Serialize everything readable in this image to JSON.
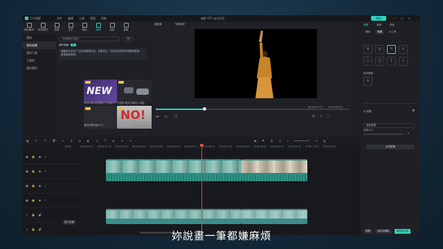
{
  "titlebar": {
    "app_name": "万兴喵影",
    "menu": [
      "文件",
      "编辑",
      "工具",
      "视图",
      "帮助"
    ],
    "document": "喵影-074 自动打码",
    "export_label": "导出"
  },
  "toolbar": {
    "tools": [
      {
        "label": "我的素材",
        "icon": "folder-icon"
      },
      {
        "label": "库存素材",
        "icon": "stock-icon"
      },
      {
        "label": "音频",
        "icon": "music-icon"
      },
      {
        "label": "文字",
        "icon": "text-icon"
      },
      {
        "label": "特效",
        "icon": "effects-icon"
      },
      {
        "label": "转场",
        "icon": "transition-icon"
      },
      {
        "label": "贴纸",
        "icon": "sticker-icon"
      },
      {
        "label": "模板",
        "icon": "template-icon"
      }
    ],
    "active_index": 5
  },
  "sidebar": {
    "items": [
      "我的",
      "我的收藏",
      "我的下载",
      "下载的",
      "我的素材"
    ],
    "selected_index": 1
  },
  "media": {
    "search_placeholder": "搜索模板与图片",
    "search_button": "全部",
    "section_title": "我的收藏",
    "section_badge": "AI",
    "notice": "隐藏尚未支持了 延迟请重新开启，如果发生，你将来会得到你想要的推荐，直接重新推荐。",
    "thumbnails": [
      {
        "caption": "NEW 新内容标题文字动画C4",
        "text": "NEW"
      },
      {
        "caption": "打招呼·聊天字幕导入动画",
        "text": ""
      },
      {
        "caption": "演说标题动画C13",
        "text": ""
      },
      {
        "caption": "红色叠加强调",
        "text": "NO!"
      }
    ]
  },
  "player": {
    "left_label": "播放器",
    "quality_label": "完美画质",
    "time_current": "00:00:03:17",
    "time_total": "00:00:09:22"
  },
  "inspector": {
    "tabs": [
      "视频",
      "音频",
      "调色"
    ],
    "active_tab": 0,
    "subtabs": [
      "基础",
      "遮罩",
      "AI工具"
    ],
    "active_subtab": 1,
    "section_label": "形状蒙版",
    "ai_label": "AI 遮罩",
    "select_label": "智能遮罩",
    "slider_label": "羽化大小",
    "slider_value": "0",
    "apply_button": "应用遮罩",
    "bottom_buttons": [
      "重置",
      "保存到模板",
      "保存并应用"
    ]
  },
  "timeline": {
    "ruler_ticks": [
      "00:00",
      "00:00:00:20",
      "00:00:01:15",
      "00:00:02:10",
      "00:00:03:05",
      "00:00:04:00",
      "00:00:04:20",
      "00:00:05:15",
      "00:00:06:10",
      "00:00:07:05",
      "00:00:08:00",
      "00:00:08:20",
      "00:00:09:15",
      "00:00:10:10",
      "00:00:11:05",
      "00:00:12:00"
    ],
    "tooltip": "插入轨道"
  },
  "subtitle": "妳說畫一筆都嫌麻煩"
}
